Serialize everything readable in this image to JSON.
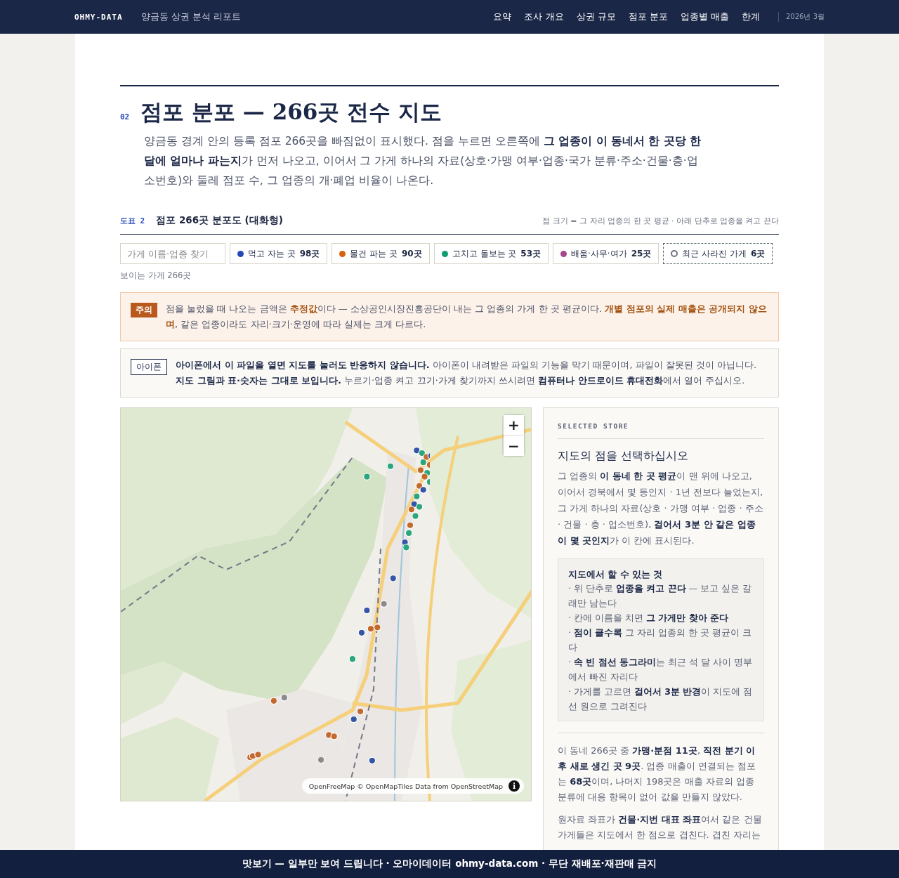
{
  "header": {
    "brand": "OHMY-DATA",
    "report_title": "양금동 상권 분석 리포트",
    "nav": [
      "요약",
      "조사 개요",
      "상권 규모",
      "점포 분포",
      "업종별 매출",
      "한계"
    ],
    "date": "2026년 3월"
  },
  "section": {
    "number": "02",
    "title": "점포 분포 — 266곳 전수 지도",
    "intro": "양금동 경계 안의 등록 점포 266곳을 빠짐없이 표시했다. 점을 누르면 오른쪽에 **그 업종이 이 동네서 한 곳당 한 달에 얼마나 파는지**가 먼저 나오고, 이어서 그 가게 하나의 자료(상호·가맹 여부·업종·국가 분류·주소·건물·층·업소번호)와 둘레 점포 수, 그 업종의 개·폐업 비율이 나온다."
  },
  "figure": {
    "label": "도표 2",
    "title": "점포 266곳 분포도 (대화형)",
    "note": "점 크기 = 그 자리 업종의 한 곳 평균 · 아래 단추로 업종을 켜고 끈다"
  },
  "search": {
    "placeholder": "가게 이름·업종 찾기"
  },
  "legend": [
    {
      "kind": "category",
      "label": "먹고 자는 곳",
      "count": "98곳",
      "color": "#2348b8"
    },
    {
      "kind": "category",
      "label": "물건 파는 곳",
      "count": "90곳",
      "color": "#d9620f"
    },
    {
      "kind": "category",
      "label": "고치고 돌보는 곳",
      "count": "53곳",
      "color": "#129a72"
    },
    {
      "kind": "category",
      "label": "배움·사무·여가",
      "count": "25곳",
      "color": "#a5478e"
    },
    {
      "kind": "removed",
      "label": "최근 사라진 가게",
      "count": "6곳",
      "color": "#6b7280"
    }
  ],
  "visible_count": "보이는 가게 266곳",
  "notices": [
    {
      "kind": "caution",
      "tag": "주의",
      "text": "점을 눌렀을 때 나오는 금액은 **추정값**이다 — 소상공인시장진흥공단이 내는 그 업종의 가게 한 곳 평균이다. **개별 점포의 실제 매출은 공개되지 않으며**, 같은 업종이라도 자리·크기·운영에 따라 실제는 크게 다르다."
    },
    {
      "kind": "info",
      "tag": "아이폰",
      "text": "**아이폰에서 이 파일을 열면 지도를 눌러도 반응하지 않습니다.** 아이폰이 내려받은 파일의 기능을 막기 때문이며, 파일이 잘못된 것이 아닙니다. **지도 그림과 표·숫자는 그대로 보입니다.** 누르기·업종 켜고 끄기·가게 찾기까지 쓰시려면 **컴퓨터나 안드로이드 휴대전화**에서 열어 주십시오."
    }
  ],
  "map": {
    "zoom_in": "+",
    "zoom_out": "−",
    "attribution": "OpenFreeMap © OpenMapTiles Data from OpenStreetMap",
    "info": "i"
  },
  "panel": {
    "eyebrow": "SELECTED STORE",
    "heading": "지도의 점을 선택하십시오",
    "body": "그 업종의 **이 동네 한 곳 평균**이 맨 위에 나오고, 이어서 경북에서 몇 등인지 · 1년 전보다 늘었는지, 그 가게 하나의 자료(상호 · 가맹 여부 · 업종 · 주소 · 건물 · 층 · 업소번호), **걸어서 3분 안 같은 업종이 몇 곳인지**가 이 칸에 표시된다.",
    "tips_title": "지도에서 할 수 있는 것",
    "tips": [
      "· 위 단추로 **업종을 켜고 끈다** — 보고 싶은 갈래만 남는다",
      "· 칸에 이름을 치면 **그 가게만 찾아 준다**",
      "· **점이 클수록** 그 자리 업종의 한 곳 평균이 크다",
      "· **속 빈 점선 동그라미**는 최근 석 달 사이 명부에서 빠진 자리다",
      "· 가게를 고르면 **걸어서 3분 반경**이 지도에 점선 원으로 그려진다"
    ],
    "notes": [
      "이 동네 266곳 중 **가맹·분점 11곳**, **직전 분기 이후 새로 생긴 곳 9곳**. 업종 매출이 연결되는 점포는 **68곳**이며, 나머지 198곳은 매출 자료의 업종 분류에 대응 항목이 없어 값을 만들지 않았다.",
      "원자료 좌표가 **건물·지번 대표 좌표**여서 같은 건물 가게들은 지도에서 한 점으로 겹친다. 겹친 자리는"
    ]
  },
  "footer": "맛보기 — 일부만 보여 드립니다 · 오마이데이터 ohmy-data.com · 무단 재배포·재판매 금지"
}
